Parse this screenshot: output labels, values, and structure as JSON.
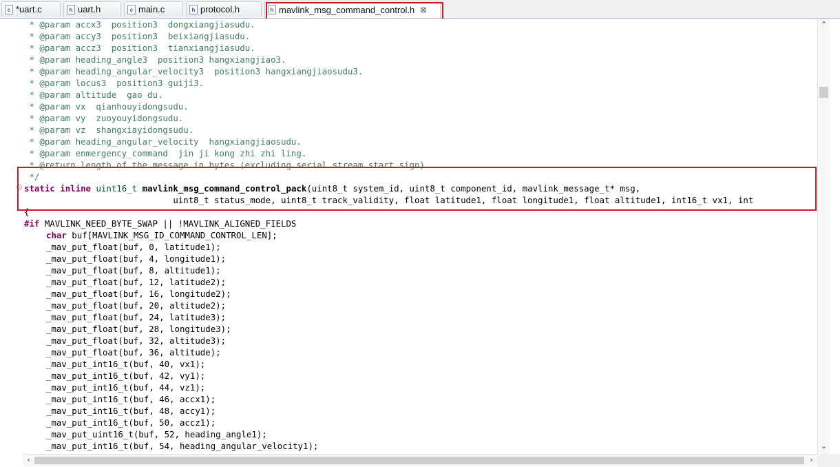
{
  "tabs": [
    {
      "label": "*uart.c",
      "icon": "c"
    },
    {
      "label": "uart.h",
      "icon": "h"
    },
    {
      "label": "main.c",
      "icon": "c"
    },
    {
      "label": "protocol.h",
      "icon": "h"
    },
    {
      "label": "mavlink_msg_command_control.h",
      "icon": "h",
      "active": true
    }
  ],
  "code": {
    "l1": " * @param accx3  position3  dongxiangjiasudu.",
    "l2": " * @param accy3  position3  beixiangjiasudu.",
    "l3": " * @param accz3  position3  tianxiangjiasudu.",
    "l4": " * @param heading_angle3  position3 hangxiangjiao3.",
    "l5": " * @param heading_angular_velocity3  position3 hangxiangjiaosudu3.",
    "l6": " * @param locus3  position3 guiji3.",
    "l7": " * @param altitude  gao du.",
    "l8": " * @param vx  qianhouyidongsudu.",
    "l9": " * @param vy  zuoyouyidongsudu.",
    "l10": " * @param vz  shangxiayidongsudu.",
    "l11": " * @param heading_angular_velocity  hangxiangjiaosudu.",
    "l12": " * @param enmergency_command  jin ji kong zhi zhi ling.",
    "l13": " * @return length of the message in bytes (excluding serial stream start sign)",
    "l14": " */",
    "sig1": {
      "kw1": "static",
      "kw2": "inline",
      "ret": "uint16_t",
      "name": "mavlink_msg_command_control_pack",
      "rest": "(uint8_t system_id, uint8_t component_id, mavlink_message_t* msg,"
    },
    "sig2": "                             uint8_t status_mode, uint8_t track_validity, float latitude1, float longitude1, float altitude1, int16_t vx1, int",
    "brace": "{",
    "pp": {
      "kw": "#if",
      "rest": " MAVLINK_NEED_BYTE_SWAP || !MAVLINK_ALIGNED_FIELDS"
    },
    "decl": {
      "kw": "char",
      "rest": " buf[MAVLINK_MSG_ID_COMMAND_CONTROL_LEN];"
    },
    "body": [
      "_mav_put_float(buf, 0, latitude1);",
      "_mav_put_float(buf, 4, longitude1);",
      "_mav_put_float(buf, 8, altitude1);",
      "_mav_put_float(buf, 12, latitude2);",
      "_mav_put_float(buf, 16, longitude2);",
      "_mav_put_float(buf, 20, altitude2);",
      "_mav_put_float(buf, 24, latitude3);",
      "_mav_put_float(buf, 28, longitude3);",
      "_mav_put_float(buf, 32, altitude3);",
      "_mav_put_float(buf, 36, altitude);",
      "_mav_put_int16_t(buf, 40, vx1);",
      "_mav_put_int16_t(buf, 42, vy1);",
      "_mav_put_int16_t(buf, 44, vz1);",
      "_mav_put_int16_t(buf, 46, accx1);",
      "_mav_put_int16_t(buf, 48, accy1);",
      "_mav_put_int16_t(buf, 50, accz1);",
      "_mav_put_uint16_t(buf, 52, heading_angle1);",
      "_mav_put_int16_t(buf, 54, heading_angular_velocity1);"
    ]
  },
  "colors": {
    "comment": "#3f7f5f",
    "keyword": "#7f0055",
    "type": "#005032",
    "highlight": "#c41e23"
  }
}
